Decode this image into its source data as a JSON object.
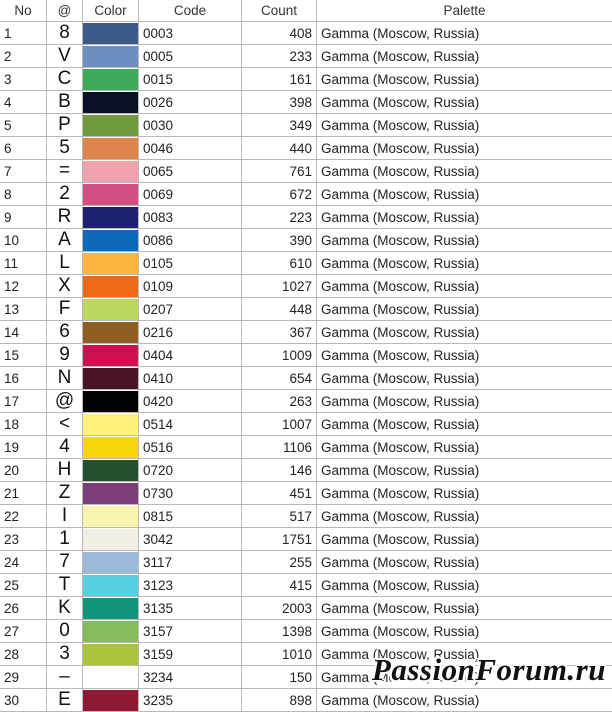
{
  "table": {
    "headers": [
      "No",
      "@",
      "Color",
      "Code",
      "Count",
      "Palette"
    ],
    "rows": [
      {
        "no": "1",
        "symbol": "8",
        "color": "#3b5a8a",
        "code": "0003",
        "count": "408",
        "palette": "Gamma (Moscow, Russia)"
      },
      {
        "no": "2",
        "symbol": "V",
        "color": "#6b90c0",
        "code": "0005",
        "count": "233",
        "palette": "Gamma (Moscow, Russia)"
      },
      {
        "no": "3",
        "symbol": "C",
        "color": "#3caa58",
        "code": "0015",
        "count": "161",
        "palette": "Gamma (Moscow, Russia)"
      },
      {
        "no": "4",
        "symbol": "B",
        "color": "#0b1125",
        "code": "0026",
        "count": "398",
        "palette": "Gamma (Moscow, Russia)"
      },
      {
        "no": "5",
        "symbol": "P",
        "color": "#6e9a3c",
        "code": "0030",
        "count": "349",
        "palette": "Gamma (Moscow, Russia)"
      },
      {
        "no": "6",
        "symbol": "5",
        "color": "#de844c",
        "code": "0046",
        "count": "440",
        "palette": "Gamma (Moscow, Russia)"
      },
      {
        "no": "7",
        "symbol": "=",
        "color": "#eea2ae",
        "code": "0065",
        "count": "761",
        "palette": "Gamma (Moscow, Russia)"
      },
      {
        "no": "8",
        "symbol": "2",
        "color": "#d24f83",
        "code": "0069",
        "count": "672",
        "palette": "Gamma (Moscow, Russia)"
      },
      {
        "no": "9",
        "symbol": "R",
        "color": "#1b2270",
        "code": "0083",
        "count": "223",
        "palette": "Gamma (Moscow, Russia)"
      },
      {
        "no": "10",
        "symbol": "A",
        "color": "#0f68b5",
        "code": "0086",
        "count": "390",
        "palette": "Gamma (Moscow, Russia)"
      },
      {
        "no": "11",
        "symbol": "L",
        "color": "#fbb43c",
        "code": "0105",
        "count": "610",
        "palette": "Gamma (Moscow, Russia)"
      },
      {
        "no": "12",
        "symbol": "X",
        "color": "#ef6a18",
        "code": "0109",
        "count": "1027",
        "palette": "Gamma (Moscow, Russia)"
      },
      {
        "no": "13",
        "symbol": "F",
        "color": "#bcd862",
        "code": "0207",
        "count": "448",
        "palette": "Gamma (Moscow, Russia)"
      },
      {
        "no": "14",
        "symbol": "6",
        "color": "#8e5e24",
        "code": "0216",
        "count": "367",
        "palette": "Gamma (Moscow, Russia)"
      },
      {
        "no": "15",
        "symbol": "9",
        "color": "#cf0f50",
        "code": "0404",
        "count": "1009",
        "palette": "Gamma (Moscow, Russia)"
      },
      {
        "no": "16",
        "symbol": "N",
        "color": "#4a1428",
        "code": "0410",
        "count": "654",
        "palette": "Gamma (Moscow, Russia)"
      },
      {
        "no": "17",
        "symbol": "@",
        "color": "#030303",
        "code": "0420",
        "count": "263",
        "palette": "Gamma (Moscow, Russia)"
      },
      {
        "no": "18",
        "symbol": "<",
        "color": "#fff27a",
        "code": "0514",
        "count": "1007",
        "palette": "Gamma (Moscow, Russia)"
      },
      {
        "no": "19",
        "symbol": "4",
        "color": "#f8d40c",
        "code": "0516",
        "count": "1106",
        "palette": "Gamma (Moscow, Russia)"
      },
      {
        "no": "20",
        "symbol": "H",
        "color": "#24502e",
        "code": "0720",
        "count": "146",
        "palette": "Gamma (Moscow, Russia)"
      },
      {
        "no": "21",
        "symbol": "Z",
        "color": "#7a3f78",
        "code": "0730",
        "count": "451",
        "palette": "Gamma (Moscow, Russia)"
      },
      {
        "no": "22",
        "symbol": "I",
        "color": "#f8f4ae",
        "code": "0815",
        "count": "517",
        "palette": "Gamma (Moscow, Russia)"
      },
      {
        "no": "23",
        "symbol": "1",
        "color": "#f2eee4",
        "code": "3042",
        "count": "1751",
        "palette": "Gamma (Moscow, Russia)"
      },
      {
        "no": "24",
        "symbol": "7",
        "color": "#9cb8da",
        "code": "3117",
        "count": "255",
        "palette": "Gamma (Moscow, Russia)"
      },
      {
        "no": "25",
        "symbol": "T",
        "color": "#58cfdf",
        "code": "3123",
        "count": "415",
        "palette": "Gamma (Moscow, Russia)"
      },
      {
        "no": "26",
        "symbol": "K",
        "color": "#0e957a",
        "code": "3135",
        "count": "2003",
        "palette": "Gamma (Moscow, Russia)"
      },
      {
        "no": "27",
        "symbol": "0",
        "color": "#88bb5c",
        "code": "3157",
        "count": "1398",
        "palette": "Gamma (Moscow, Russia)"
      },
      {
        "no": "28",
        "symbol": "3",
        "color": "#abc53a",
        "code": "3159",
        "count": "1010",
        "palette": "Gamma (Moscow, Russia)"
      },
      {
        "no": "29",
        "symbol": "–",
        "color": "#ffffff",
        "code": "3234",
        "count": "150",
        "palette": "Gamma (Moscow, Russia)"
      },
      {
        "no": "30",
        "symbol": "E",
        "color": "#8e1a35",
        "code": "3235",
        "count": "898",
        "palette": "Gamma (Moscow, Russia)"
      }
    ]
  },
  "watermark": "PassionForum.ru"
}
